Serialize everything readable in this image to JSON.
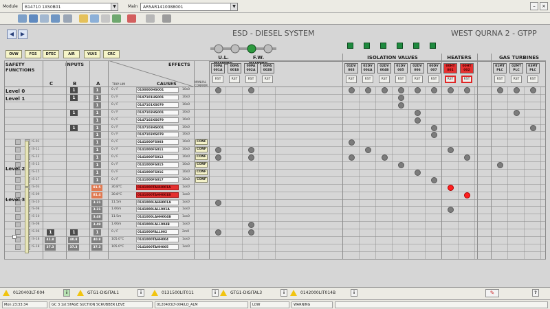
{
  "top": {
    "module_label": "Module",
    "module_value": "B14710 1XS0B01",
    "main_label": "Main",
    "main_value": "AR5AR1410088001"
  },
  "system_buttons": [
    "OVW",
    "FGS",
    "DTEC",
    "AIR",
    "VLVS",
    "CRC"
  ],
  "header": {
    "title": "ESD - DIESEL SYSTEM",
    "site": "WEST QURNA 2 - GTPP"
  },
  "groups": {
    "ul_pumps": "U.L. PUMPS",
    "fw_pumps": "F.W. PUMPS",
    "iso_valves": "ISOLATION VALVES",
    "heaters": "HEATERS",
    "gas_turbines": "GAS TURBINES"
  },
  "matrix_headers": {
    "safety": "SAFETY\nFUNCTIONS",
    "inputs": "INPUTS",
    "effects": "EFFECTS",
    "causes": "CAUSES",
    "trip_lim": "TRIP LIM",
    "manual": "MANUAL CONFIRM",
    "col_c": "C",
    "col_b": "B",
    "col_a": "A"
  },
  "columns": [
    {
      "tag": "00PA\n001A",
      "red": false
    },
    {
      "tag": "00PA\n001B",
      "red": false
    },
    {
      "tag": "00PA\n002A",
      "red": false
    },
    {
      "tag": "00PA\n002B",
      "red": false
    },
    {
      "tag": "01DV\n003",
      "red": false
    },
    {
      "tag": "02DV\n004A",
      "red": false
    },
    {
      "tag": "02DV\n004B",
      "red": false
    },
    {
      "tag": "01DV\n005",
      "red": false
    },
    {
      "tag": "02DV\n006",
      "red": false
    },
    {
      "tag": "00DV\n007",
      "red": false
    },
    {
      "tag": "00HT\n001",
      "red": true
    },
    {
      "tag": "00HT\n002",
      "red": true
    },
    {
      "tag": "01MT\nPLC",
      "red": false
    },
    {
      "tag": "02MT\nPLC",
      "red": false
    },
    {
      "tag": "03MT\nPLC",
      "red": false
    }
  ],
  "reset_label": "RST",
  "levels": [
    "Level 0",
    "Level 1",
    "Level 2",
    "Level 3"
  ],
  "rows": [
    {
      "sf": "",
      "c": "",
      "b": "1",
      "a": "1",
      "trip": "0 / F",
      "cause": "0100000HS001",
      "dly": "10s0",
      "conf": "",
      "dots": [
        0,
        2,
        4,
        5,
        6,
        7,
        8,
        9,
        10,
        11,
        12,
        13,
        14
      ],
      "red": false
    },
    {
      "sf": "",
      "c": "",
      "b": "1",
      "a": "1",
      "trip": "0 / F",
      "cause": "0147101HS001",
      "dly": "10s0",
      "conf": "",
      "dots": [
        7
      ],
      "red": false
    },
    {
      "sf": "",
      "c": "",
      "b": "",
      "a": "1",
      "trip": "0 / F",
      "cause": "0147101XS079",
      "dly": "10s0",
      "conf": "",
      "dots": [
        7
      ],
      "red": false
    },
    {
      "sf": "",
      "c": "",
      "b": "1",
      "a": "1",
      "trip": "0 / F",
      "cause": "0147102HS001",
      "dly": "10s0",
      "conf": "",
      "dots": [
        8,
        13
      ],
      "red": false
    },
    {
      "sf": "",
      "c": "",
      "b": "",
      "a": "1",
      "trip": "0 / F",
      "cause": "0147102XS079",
      "dly": "10s0",
      "conf": "",
      "dots": [
        8
      ],
      "red": false
    },
    {
      "sf": "",
      "c": "",
      "b": "1",
      "a": "1",
      "trip": "0 / F",
      "cause": "0147103HS001",
      "dly": "10s0",
      "conf": "",
      "dots": [
        9,
        14
      ],
      "red": false
    },
    {
      "sf": "",
      "c": "",
      "b": "",
      "a": "1",
      "trip": "0 / F",
      "cause": "0147103XS079",
      "dly": "10s0",
      "conf": "",
      "dots": [
        9
      ],
      "red": false
    },
    {
      "sf": "IS-01",
      "c": "",
      "b": "",
      "a": "1",
      "trip": "0 / F",
      "cause": "0141000FS003",
      "dly": "10s0",
      "conf": "CONF",
      "dots": [
        4
      ],
      "red": false
    },
    {
      "sf": "IS-11",
      "c": "",
      "b": "",
      "a": "1",
      "trip": "0 / F",
      "cause": "0141000FS011",
      "dly": "10s0",
      "conf": "CONF",
      "dots": [
        0,
        2,
        5,
        10
      ],
      "red": false
    },
    {
      "sf": "IS-12",
      "c": "",
      "b": "",
      "a": "1",
      "trip": "0 / F",
      "cause": "0141000FS012",
      "dly": "10s0",
      "conf": "CONF",
      "dots": [
        0,
        2,
        4,
        6,
        11
      ],
      "red": false
    },
    {
      "sf": "IS-13",
      "c": "",
      "b": "",
      "a": "1",
      "trip": "0 / F",
      "cause": "0141000FS015",
      "dly": "10s0",
      "conf": "CONF",
      "dots": [
        7,
        12
      ],
      "red": false
    },
    {
      "sf": "IS-15",
      "c": "",
      "b": "",
      "a": "1",
      "trip": "0 / F",
      "cause": "0141000FS016",
      "dly": "10s0",
      "conf": "CONF",
      "dots": [
        8
      ],
      "red": false
    },
    {
      "sf": "IS-17",
      "c": "",
      "b": "",
      "a": "1",
      "trip": "0 / F",
      "cause": "0141000FS017",
      "dly": "10s0",
      "conf": "CONF",
      "dots": [
        9
      ],
      "red": false
    },
    {
      "sf": "IS-03",
      "c": "",
      "b": "",
      "a": "81.5",
      "trip": "30.8°C",
      "cause": "0141000TAHH001A",
      "dly": "1os0",
      "conf": "",
      "dots": [
        10
      ],
      "red": true
    },
    {
      "sf": "IS-09",
      "c": "",
      "b": "",
      "a": "81.4",
      "trip": "30.8°C",
      "cause": "0141000TAHH001B",
      "dly": "1os0",
      "conf": "",
      "dots": [
        11
      ],
      "red": true
    },
    {
      "sf": "IS-10",
      "c": "",
      "b": "",
      "a": "3.31",
      "trip": "11.5m",
      "cause": "0141000LAHH001A",
      "dly": "1os0",
      "conf": "",
      "dots": [
        0
      ],
      "red": false
    },
    {
      "sf": "IS-08",
      "c": "",
      "b": "",
      "a": "3.31",
      "trip": "1.00m",
      "cause": "0141000LALL001A",
      "dly": "1os0",
      "conf": "",
      "dots": [
        10
      ],
      "red": false
    },
    {
      "sf": "IS-10",
      "c": "",
      "b": "",
      "a": "3.48",
      "trip": "11.5m",
      "cause": "0141000LAHH004B",
      "dly": "1os0",
      "conf": "",
      "dots": [],
      "red": false
    },
    {
      "sf": "IS-08",
      "c": "",
      "b": "",
      "a": "3.49",
      "trip": "1.00m",
      "cause": "0141000LALL004B",
      "dly": "1os0",
      "conf": "",
      "dots": [
        2
      ],
      "red": false
    },
    {
      "sf": "IS-06",
      "c": "1",
      "b": "1",
      "a": "1",
      "trip": "0 / F",
      "cause": "0141000FALL002",
      "dly": "2m0",
      "conf": "",
      "dots": [
        0,
        2
      ],
      "red": false
    },
    {
      "sf": "IS-18",
      "c": "41.8",
      "b": "40.8",
      "a": "40.8",
      "trip": "105.0°C",
      "cause": "0141000TAHH004",
      "dly": "1os0",
      "conf": "",
      "dots": [],
      "red": false
    },
    {
      "sf": "IS-18",
      "c": "37.3",
      "b": "37.3",
      "a": "37.3",
      "trip": "105.0°C",
      "cause": "0141000TAHH005",
      "dly": "1os0",
      "conf": "",
      "dots": [],
      "red": false
    }
  ],
  "alarms": [
    {
      "tag": "0120403LT-004",
      "btn": "i"
    },
    {
      "tag": "GTG1-DIGITAL1",
      "btn": "i"
    },
    {
      "tag": "0131500LIT011",
      "btn": "i"
    },
    {
      "tag": "GTG1-DIGITAL3",
      "btn": "i"
    },
    {
      "tag": "0142000LIT014B",
      "btn": "i"
    }
  ],
  "status": {
    "time": "Mon 23:33:34",
    "desc": "GC 3 1st STAGE SUCTION SCRUBBER LEVE",
    "tag": "0120403LT-004/LO_ALM",
    "level": "LOW",
    "state": "WARNING",
    "help": "?"
  },
  "colors": {
    "red": "#e43030",
    "green": "#1f8a3f",
    "dot": "#7c7c7c",
    "yellow": "#f4f2c9"
  }
}
